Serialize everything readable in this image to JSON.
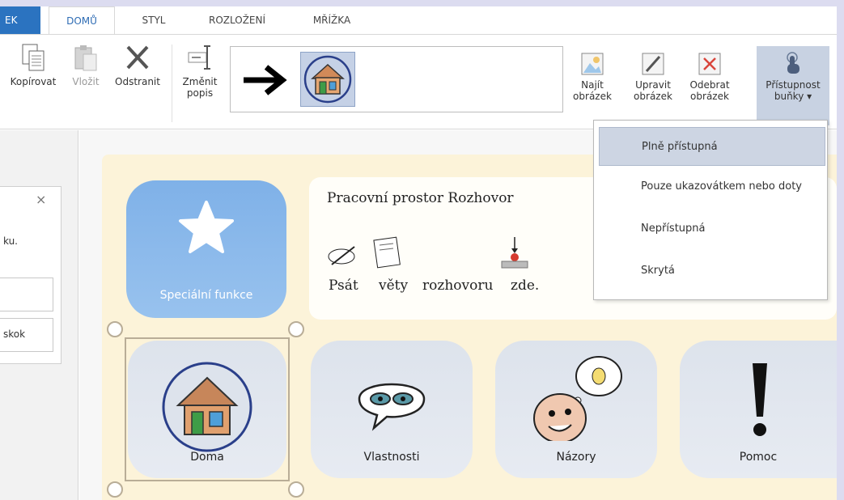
{
  "tabs": [
    {
      "label": "EK"
    },
    {
      "label": "DOMŮ"
    },
    {
      "label": "STYL"
    },
    {
      "label": "ROZLOŽENÍ"
    },
    {
      "label": "MŘÍŽKA"
    }
  ],
  "ribbon": {
    "copy": "Kopírovat",
    "paste": "Vložit",
    "delete": "Odstranit",
    "change_desc_1": "Změnit",
    "change_desc_2": "popis",
    "find_image_1": "Najít",
    "find_image_2": "obrázek",
    "edit_image_1": "Upravit",
    "edit_image_2": "obrázek",
    "remove_image_1": "Odebrat",
    "remove_image_2": "obrázek",
    "access_1": "Přístupnost",
    "access_2": "buňky ▾"
  },
  "panel": {
    "close": "×",
    "text": "ku.",
    "field2": "skok"
  },
  "grid": {
    "special_label": "Speciální funkce",
    "chat_title": "Pracovní prostor Rozhovor",
    "chat_words": [
      "Psát",
      "věty",
      "rozhovoru",
      "zde."
    ],
    "cells": [
      {
        "label": "Doma"
      },
      {
        "label": "Vlastnosti"
      },
      {
        "label": "Názory"
      },
      {
        "label": "Pomoc"
      }
    ]
  },
  "menu": {
    "items": [
      {
        "label": "Plně přístupná"
      },
      {
        "label": "Pouze ukazovátkem nebo doty"
      },
      {
        "label": "Nepřístupná"
      },
      {
        "label": "Skrytá"
      }
    ]
  },
  "colors": {
    "accent": "#2b73c0",
    "board": "#fcf3d9",
    "special": "#8ab9ec"
  }
}
